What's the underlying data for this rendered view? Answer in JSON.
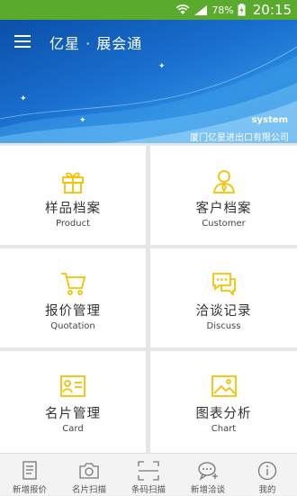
{
  "status": {
    "battery": "78%",
    "time": "20:15"
  },
  "header": {
    "title": "亿星 · 展会通",
    "user": "system",
    "company": "厦门亿星进出口有限公司"
  },
  "tiles": [
    {
      "cn": "样品档案",
      "en": "Product",
      "icon": "gift-icon"
    },
    {
      "cn": "客户档案",
      "en": "Customer",
      "icon": "user-icon"
    },
    {
      "cn": "报价管理",
      "en": "Quotation",
      "icon": "cart-icon"
    },
    {
      "cn": "洽谈记录",
      "en": "Discuss",
      "icon": "chat-icon"
    },
    {
      "cn": "名片管理",
      "en": "Card",
      "icon": "card-icon"
    },
    {
      "cn": "图表分析",
      "en": "Chart",
      "icon": "image-chart-icon"
    }
  ],
  "bottom_nav": [
    {
      "label": "新增报价",
      "icon": "document-icon"
    },
    {
      "label": "名片扫描",
      "icon": "camera-icon"
    },
    {
      "label": "条码扫描",
      "icon": "scan-icon"
    },
    {
      "label": "新增洽谈",
      "icon": "chat-add-icon"
    },
    {
      "label": "我的",
      "icon": "info-icon"
    }
  ],
  "colors": {
    "accent": "#f2c200",
    "header": "#1a6fcf",
    "statusbar": "#5aaa2e"
  }
}
